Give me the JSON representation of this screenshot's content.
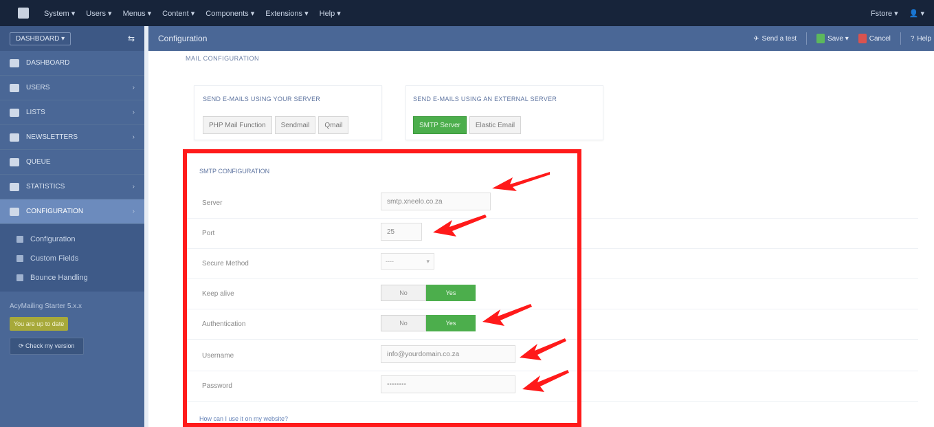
{
  "menubar": {
    "items": [
      "System ▾",
      "Users ▾",
      "Menus ▾",
      "Content ▾",
      "Components ▾",
      "Extensions ▾",
      "Help ▾"
    ],
    "right": [
      "Fstore ▾",
      "👤 ▾"
    ]
  },
  "toolbar": {
    "title": "Configuration",
    "actions": {
      "test": "Send a test",
      "save": "Save ▾",
      "cancel": "Cancel",
      "help": "Help"
    }
  },
  "sidebar": {
    "head_btn": "DASHBOARD ▾",
    "toggle": "⇆",
    "items": [
      {
        "label": "Dashboard",
        "chev": ""
      },
      {
        "label": "Users",
        "chev": "›"
      },
      {
        "label": "Lists",
        "chev": "›"
      },
      {
        "label": "Newsletters",
        "chev": "›"
      },
      {
        "label": "Queue",
        "chev": ""
      },
      {
        "label": "Statistics",
        "chev": "›"
      },
      {
        "label": "Configuration",
        "chev": "›"
      }
    ],
    "sub": [
      "Configuration",
      "Custom Fields",
      "Bounce Handling"
    ],
    "version": "AcyMailing Starter 5.x.x",
    "update_btn": "You are up to date",
    "check_btn": "⟳ Check my version"
  },
  "main": {
    "section_title": "Mail configuration",
    "panel_local": {
      "title": "Send e-mails using your server",
      "buttons": [
        "PHP Mail Function",
        "Sendmail",
        "Qmail"
      ]
    },
    "panel_ext": {
      "title": "Send e-mails using an external server",
      "buttons": [
        "SMTP Server",
        "Elastic Email"
      ]
    },
    "smtp": {
      "title": "SMTP configuration",
      "server_label": "Server",
      "server_value": "smtp.xneelo.co.za",
      "port_label": "Port",
      "port_value": "25",
      "secure_label": "Secure Method",
      "secure_value": "----",
      "keepalive_label": "Keep alive",
      "auth_label": "Authentication",
      "username_label": "Username",
      "username_value": "info@yourdomain.co.za",
      "password_label": "Password",
      "password_value": "••••••••",
      "toggle_no": "No",
      "toggle_yes": "Yes",
      "link": "How can I use it on my website?"
    }
  },
  "colors": {
    "highlight": "#ff1a1a",
    "green": "#4cae4c",
    "sidebar": "#4a6796"
  }
}
